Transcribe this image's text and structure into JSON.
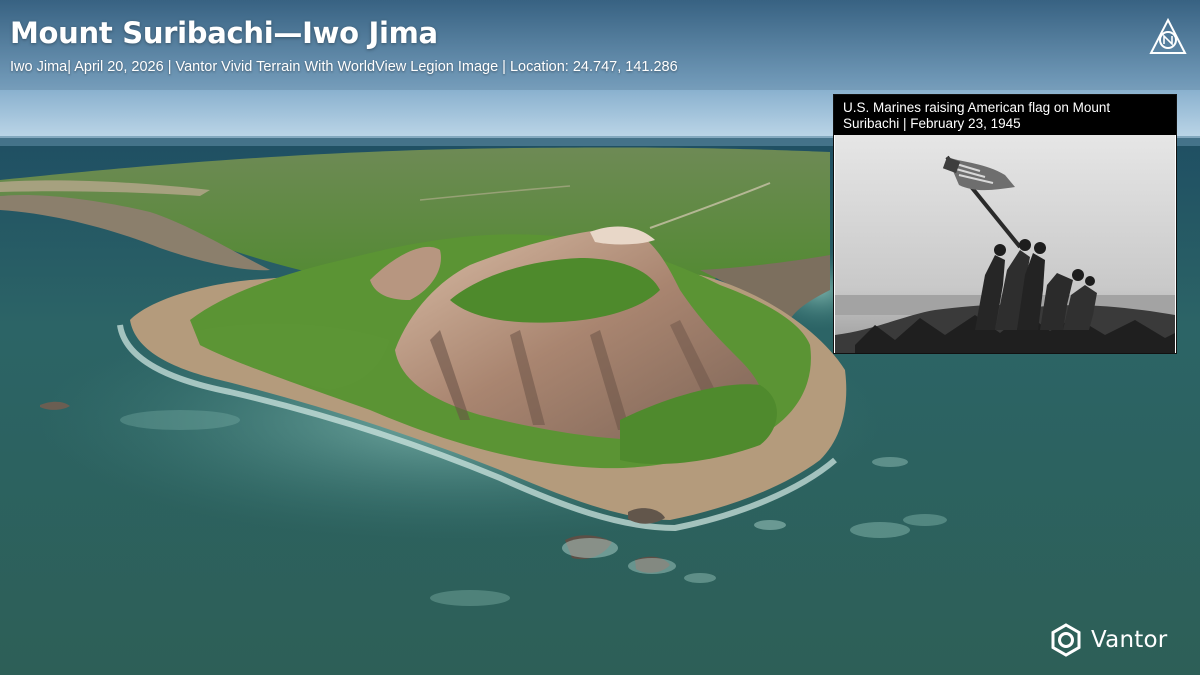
{
  "header": {
    "title": "Mount Suribachi—Iwo Jima",
    "subtitle": "Iwo Jima| April 20, 2026 | Vantor Vivid Terrain With WorldView Legion Image | Location: 24.747, 141.286"
  },
  "inset": {
    "caption": "U.S. Marines raising American flag on Mount Suribachi | February 23, 1945"
  },
  "logo": {
    "text": "Vantor",
    "icon": "vantor-logo-icon"
  },
  "icons": {
    "top_right": "compass-brand-icon"
  },
  "colors": {
    "sky_top": "#3f6b8e",
    "sky_bottom": "#bcd6e8",
    "ocean": "#2f6567",
    "vegetation": "#5e9a3a",
    "cliff": "#c7a58d",
    "caption_bg": "#000000",
    "text": "#ffffff"
  }
}
